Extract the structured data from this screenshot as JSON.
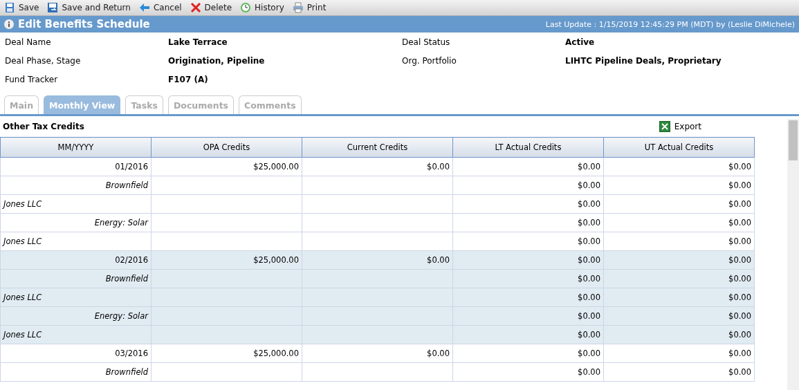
{
  "toolbar": [
    {
      "kind": "save",
      "label": "Save"
    },
    {
      "kind": "save-return",
      "label": "Save and Return"
    },
    {
      "kind": "cancel",
      "label": "Cancel"
    },
    {
      "kind": "delete",
      "label": "Delete"
    },
    {
      "kind": "history",
      "label": "History"
    },
    {
      "kind": "print",
      "label": "Print"
    }
  ],
  "header": {
    "title": "Edit Benefits Schedule",
    "last_update": "Last Update : 1/15/2019 12:45:29 PM (MDT) by (Leslie DiMichele)"
  },
  "fields": [
    {
      "label": "Deal Name",
      "value": "Lake Terrace"
    },
    {
      "label": "Deal Status",
      "value": "Active"
    },
    {
      "label": "Deal Phase, Stage",
      "value": "Origination, Pipeline"
    },
    {
      "label": "Org. Portfolio",
      "value": "LIHTC Pipeline Deals, Proprietary"
    },
    {
      "label": "Fund Tracker",
      "value": "F107 (A)"
    }
  ],
  "tabs": [
    {
      "label": "Main",
      "selected": false
    },
    {
      "label": "Monthly View",
      "selected": true
    },
    {
      "label": "Tasks",
      "selected": false
    },
    {
      "label": "Documents",
      "selected": false
    },
    {
      "label": "Comments",
      "selected": false
    }
  ],
  "section": {
    "title": "Other Tax Credits",
    "export": "Export"
  },
  "table": {
    "columns": [
      "MM/YYYY",
      "OPA Credits",
      "Current Credits",
      "LT Actual Credits",
      "UT Actual Credits"
    ],
    "rows": [
      {
        "kind": "month",
        "shaded": false,
        "cells": [
          "01/2016",
          "$25,000.00",
          "$0.00",
          "$0.00",
          "$0.00"
        ]
      },
      {
        "kind": "category",
        "shaded": false,
        "cells": [
          "Brownfield",
          "",
          "",
          "$0.00",
          "$0.00"
        ]
      },
      {
        "kind": "company",
        "shaded": false,
        "cells": [
          "Jones LLC",
          "",
          "",
          "$0.00",
          "$0.00"
        ]
      },
      {
        "kind": "category",
        "shaded": false,
        "cells": [
          "Energy: Solar",
          "",
          "",
          "$0.00",
          "$0.00"
        ]
      },
      {
        "kind": "company",
        "shaded": false,
        "cells": [
          "Jones LLC",
          "",
          "",
          "$0.00",
          "$0.00"
        ]
      },
      {
        "kind": "month",
        "shaded": true,
        "cells": [
          "02/2016",
          "$25,000.00",
          "$0.00",
          "$0.00",
          "$0.00"
        ]
      },
      {
        "kind": "category",
        "shaded": true,
        "cells": [
          "Brownfield",
          "",
          "",
          "$0.00",
          "$0.00"
        ]
      },
      {
        "kind": "company",
        "shaded": true,
        "cells": [
          "Jones LLC",
          "",
          "",
          "$0.00",
          "$0.00"
        ]
      },
      {
        "kind": "category",
        "shaded": true,
        "cells": [
          "Energy: Solar",
          "",
          "",
          "$0.00",
          "$0.00"
        ]
      },
      {
        "kind": "company",
        "shaded": true,
        "cells": [
          "Jones LLC",
          "",
          "",
          "$0.00",
          "$0.00"
        ]
      },
      {
        "kind": "month",
        "shaded": false,
        "cells": [
          "03/2016",
          "$25,000.00",
          "$0.00",
          "$0.00",
          "$0.00"
        ]
      },
      {
        "kind": "category",
        "shaded": false,
        "cells": [
          "Brownfield",
          "",
          "",
          "$0.00",
          "$0.00"
        ]
      }
    ]
  }
}
